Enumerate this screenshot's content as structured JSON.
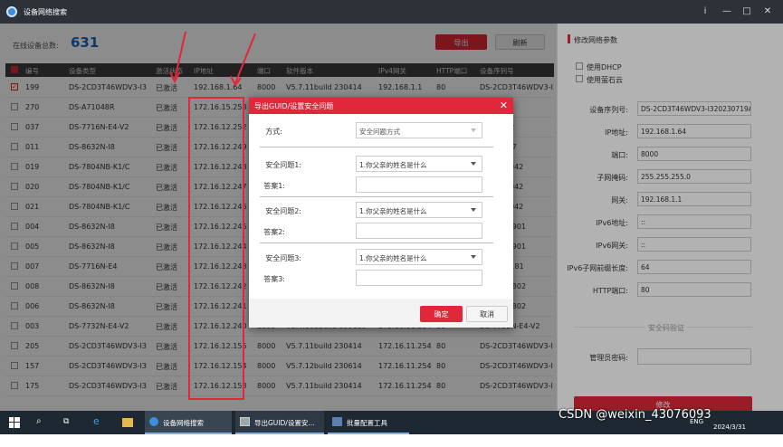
{
  "window": {
    "title": "设备网络搜索",
    "help_icon": "i",
    "min_icon": "—",
    "max_icon": "□",
    "close_icon": "✕"
  },
  "header": {
    "count_label": "在线设备总数:",
    "count": "631",
    "export_label": "导出",
    "refresh_label": "刷新"
  },
  "table": {
    "columns": [
      "编号",
      "设备类型",
      "激活状态",
      "IP地址",
      "端口",
      "软件版本",
      "IPv4网关",
      "HTTP端口",
      "设备序列号"
    ],
    "rows": [
      {
        "id": "199",
        "type": "DS-2CD3T46WDV3-I3",
        "status": "已激活",
        "ip": "192.168.1.64",
        "port": "8000",
        "version": "V5.7.11build 230414",
        "gateway": "192.168.1.1",
        "http": "80",
        "serial": "DS-2CD3T46WDV3-I3",
        "checked": true
      },
      {
        "id": "270",
        "type": "DS-A71048R",
        "status": "已激活",
        "ip": "172.16.15.253",
        "port": "",
        "version": "",
        "gateway": "",
        "http": "",
        "serial": "S"
      },
      {
        "id": "037",
        "type": "DS-7716N-E4-V2",
        "status": "已激活",
        "ip": "172.16.12.252",
        "port": "",
        "version": "",
        "gateway": "",
        "http": "",
        "serial": "E4-V2162"
      },
      {
        "id": "011",
        "type": "DS-8632N-I8",
        "status": "已激活",
        "ip": "172.16.12.249",
        "port": "",
        "version": "",
        "gateway": "",
        "http": "",
        "serial": "-I8162017"
      },
      {
        "id": "019",
        "type": "DS-7804NB-K1/C",
        "status": "已激活",
        "ip": "172.16.12.248",
        "port": "",
        "version": "",
        "gateway": "",
        "http": "",
        "serial": "NB-K1/C042"
      },
      {
        "id": "020",
        "type": "DS-7804NB-K1/C",
        "status": "已激活",
        "ip": "172.16.12.247",
        "port": "",
        "version": "",
        "gateway": "",
        "http": "",
        "serial": "NB-K1/C042"
      },
      {
        "id": "021",
        "type": "DS-7804NB-K1/C",
        "status": "已激活",
        "ip": "172.16.12.246",
        "port": "",
        "version": "",
        "gateway": "",
        "http": "",
        "serial": "NB-K1/C042"
      },
      {
        "id": "004",
        "type": "DS-8632N-I8",
        "status": "已激活",
        "ip": "172.16.12.245",
        "port": "",
        "version": "",
        "gateway": "",
        "http": "",
        "serial": "-I816201901"
      },
      {
        "id": "005",
        "type": "DS-8632N-I8",
        "status": "已激活",
        "ip": "172.16.12.244",
        "port": "",
        "version": "",
        "gateway": "",
        "http": "",
        "serial": "-I816201901"
      },
      {
        "id": "007",
        "type": "DS-7716N-E4",
        "status": "已激活",
        "ip": "172.16.12.243",
        "port": "",
        "version": "",
        "gateway": "",
        "http": "",
        "serial": "-E41620181"
      },
      {
        "id": "008",
        "type": "DS-8632N-I8",
        "status": "已激活",
        "ip": "172.16.12.242",
        "port": "",
        "version": "",
        "gateway": "",
        "http": "",
        "serial": "-I816201802"
      },
      {
        "id": "006",
        "type": "DS-8632N-I8",
        "status": "已激活",
        "ip": "172.16.12.241",
        "port": "",
        "version": "",
        "gateway": "",
        "http": "",
        "serial": "-I816201802"
      },
      {
        "id": "003",
        "type": "DS-7732N-E4-V2",
        "status": "已激活",
        "ip": "172.16.12.240",
        "port": "8000",
        "version": "V3.4.103build 190130",
        "gateway": "172.16.11.254",
        "http": "80",
        "serial": "DS-7732N-E4-V2"
      },
      {
        "id": "205",
        "type": "DS-2CD3T46WDV3-I3",
        "status": "已激活",
        "ip": "172.16.12.155",
        "port": "8000",
        "version": "V5.7.11build 230414",
        "gateway": "172.16.11.254",
        "http": "80",
        "serial": "DS-2CD3T46WDV3-I"
      },
      {
        "id": "157",
        "type": "DS-2CD3T46WDV3-I3",
        "status": "已激活",
        "ip": "172.16.12.154",
        "port": "8000",
        "version": "V5.7.12build 230614",
        "gateway": "172.16.11.254",
        "http": "80",
        "serial": "DS-2CD3T46WDV3-I"
      },
      {
        "id": "175",
        "type": "DS-2CD3T46WDV3-I3",
        "status": "已激活",
        "ip": "172.16.12.153",
        "port": "8000",
        "version": "V5.7.11build 230414",
        "gateway": "172.16.11.254",
        "http": "80",
        "serial": "DS-2CD3T46WDV3-I"
      }
    ]
  },
  "right_panel": {
    "title": "修改网络参数",
    "dhcp_label": "使用DHCP",
    "hik_label": "使用萤石云",
    "fields": [
      {
        "label": "设备序列号:",
        "value": "DS-2CD3T46WDV3-I320230719AA"
      },
      {
        "label": "IP地址:",
        "value": "192.168.1.64"
      },
      {
        "label": "端口:",
        "value": "8000"
      },
      {
        "label": "子网掩码:",
        "value": "255.255.255.0"
      },
      {
        "label": "网关:",
        "value": "192.168.1.1"
      },
      {
        "label": "IPv6地址:",
        "value": "::"
      },
      {
        "label": "IPv6网关:",
        "value": "::"
      },
      {
        "label": "IPv6子网前缀长度:",
        "value": "64"
      },
      {
        "label": "HTTP端口:",
        "value": "80"
      }
    ],
    "security_label": "安全码验证",
    "admin_pw_label": "管理员密码:",
    "modify_label": "修改"
  },
  "dialog": {
    "title": "导出GUID/设置安全问题",
    "method_label": "方式:",
    "method_value": "安全问题方式",
    "q1_label": "安全问题1:",
    "q1_value": "1.你父亲的姓名是什么",
    "a1_label": "答案1:",
    "q2_label": "安全问题2:",
    "q2_value": "1.你父亲的姓名是什么",
    "a2_label": "答案2:",
    "q3_label": "安全问题3:",
    "q3_value": "1.你父亲的姓名是什么",
    "a3_label": "答案3:",
    "ok_label": "确定",
    "cancel_label": "取消"
  },
  "taskbar": {
    "items": [
      "设备网络搜索",
      "导出GUID/设置安...",
      "批量配置工具"
    ],
    "lang": "ENG",
    "date": "2024/3/31",
    "watermark": "CSDN @weixin_43076093"
  },
  "colors": {
    "accent": "#e0283a",
    "titlebar": "#2d3238",
    "count": "#1a67c4"
  }
}
